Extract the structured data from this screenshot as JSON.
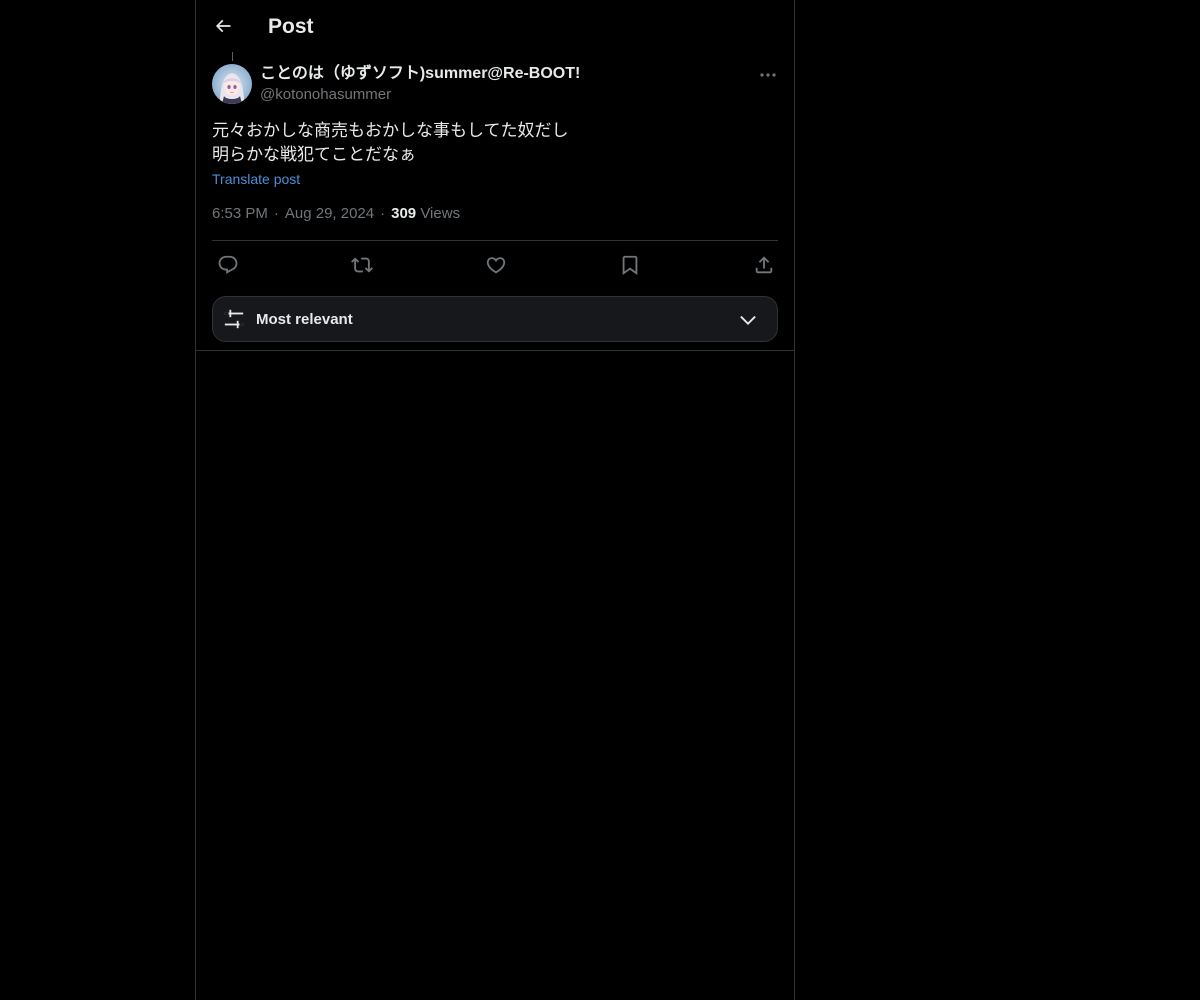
{
  "header": {
    "title": "Post",
    "back_icon": "arrow-left-icon"
  },
  "post": {
    "author": {
      "display_name": "ことのは（ゆずソフト)summer@Re-BOOT!",
      "handle": "@kotonohasummer"
    },
    "text_lines": [
      "元々おかしな商売もおかしな事もしてた奴だし",
      "明らかな戦犯てことだなぁ"
    ],
    "translate_label": "Translate post",
    "time": "6:53 PM",
    "date": "Aug 29, 2024",
    "views_count": "309",
    "views_label": "Views",
    "separator": "·"
  },
  "actions": {
    "reply_icon": "reply-icon",
    "repost_icon": "repost-icon",
    "like_icon": "heart-icon",
    "bookmark_icon": "bookmark-icon",
    "share_icon": "share-icon"
  },
  "sort": {
    "label": "Most relevant"
  },
  "colors": {
    "background": "#000000",
    "text_primary": "#e7e9ea",
    "text_secondary": "#71767b",
    "link": "#4b8fd6",
    "border": "#2f3336"
  }
}
